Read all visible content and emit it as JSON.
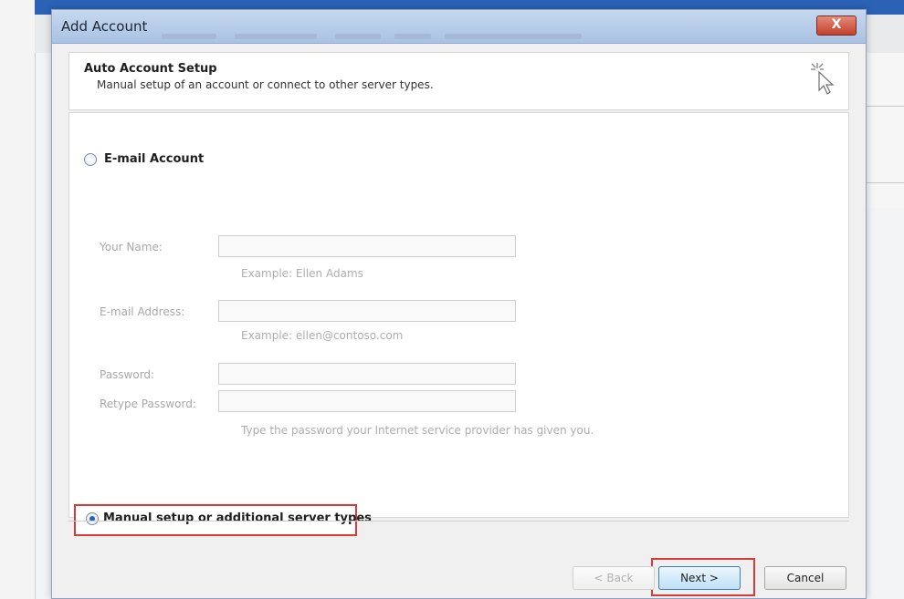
{
  "dialog": {
    "title": "Add Account",
    "close_label": "X"
  },
  "header": {
    "title": "Auto Account Setup",
    "subtitle": "Manual setup of an account or connect to other server types."
  },
  "email_account": {
    "label": "E-mail Account",
    "fields": {
      "your_name": {
        "label": "Your Name:",
        "value": "",
        "example": "Example: Ellen Adams"
      },
      "email_address": {
        "label": "E-mail Address:",
        "value": "",
        "example": "Example: ellen@contoso.com"
      },
      "password": {
        "label": "Password:",
        "value": ""
      },
      "retype_password": {
        "label": "Retype Password:",
        "value": "",
        "hint": "Type the password your Internet service provider has given you."
      }
    }
  },
  "manual_setup": {
    "label": "Manual setup or additional server types",
    "selected": true
  },
  "buttons": {
    "back": "< Back",
    "next": "Next >",
    "cancel": "Cancel"
  },
  "colors": {
    "highlight": "#d63a3a",
    "title_bar": "#b8cde9"
  }
}
